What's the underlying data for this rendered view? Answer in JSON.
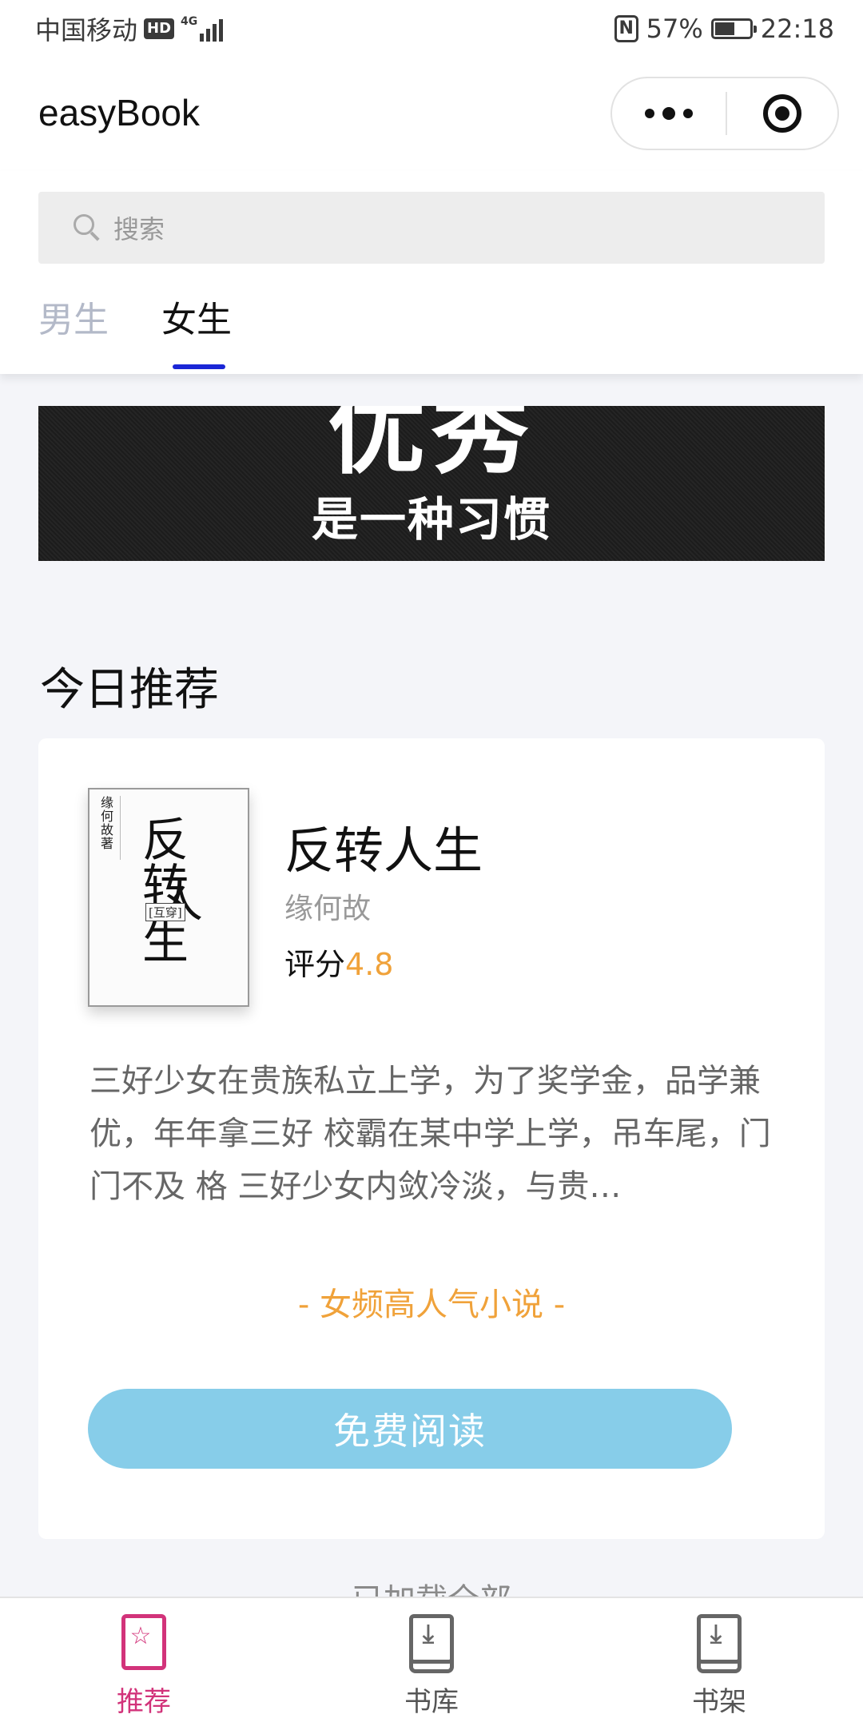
{
  "status_bar": {
    "carrier": "中国移动",
    "hd": "HD",
    "network": "4G",
    "nfc": "N",
    "battery_percent": "57%",
    "battery_level": 0.57,
    "time": "22:18"
  },
  "header": {
    "title": "easyBook",
    "more_icon": "ellipsis-icon",
    "close_icon": "target-icon"
  },
  "search": {
    "placeholder": "搜索"
  },
  "tabs": [
    {
      "label": "男生",
      "active": false
    },
    {
      "label": "女生",
      "active": true
    }
  ],
  "banner": {
    "headline": "优秀",
    "subline": "是一种习惯"
  },
  "section": {
    "title": "今日推荐"
  },
  "book": {
    "title": "反转人生",
    "author": "缘何故",
    "rating_label": "评分",
    "rating": "4.8",
    "summary": " 三好少女在贵族私立上学，为了奖学金，品学兼优，年年拿三好 校霸在某中学上学，吊车尾，门门不及 格 三好少女内敛冷淡，与贵…",
    "tagline": "- 女频高人气小说 -",
    "read_button": "免费阅读",
    "cover": {
      "author": "缘何故著",
      "title_chars": [
        "反",
        "转",
        "人",
        "生"
      ],
      "tag": "[互穿]"
    }
  },
  "footer_text": "已加载全部",
  "bottom_nav": [
    {
      "label": "推荐",
      "icon": "star-book-icon",
      "active": true
    },
    {
      "label": "书库",
      "icon": "download-book-icon",
      "active": false
    },
    {
      "label": "书架",
      "icon": "download-book-icon",
      "active": false
    }
  ],
  "colors": {
    "accent_blue": "#1a26d6",
    "rating_orange": "#f0a23a",
    "button_blue": "#87cde9",
    "nav_active": "#d2337a"
  }
}
